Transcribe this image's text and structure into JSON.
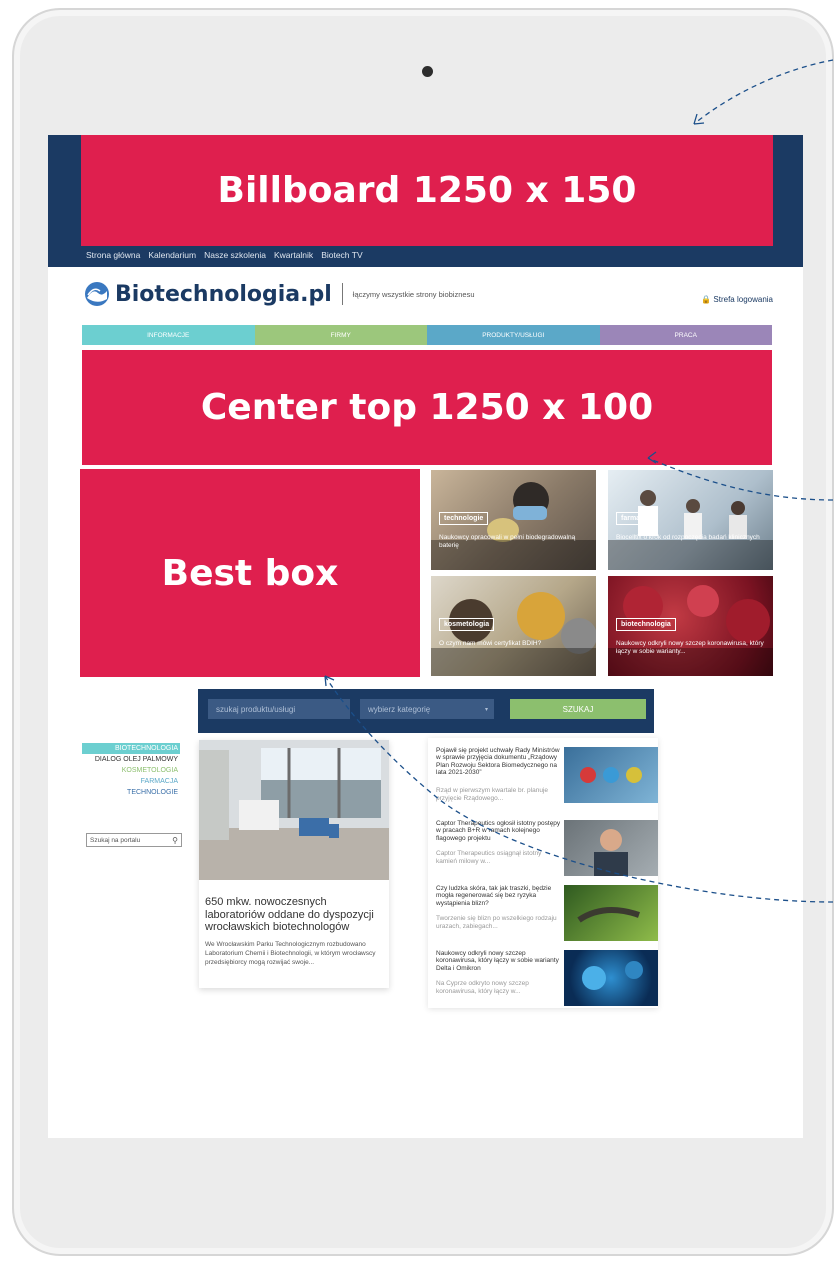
{
  "ads": {
    "billboard": "Billboard 1250 x 150",
    "center_top": "Center top 1250 x 100",
    "best_box": "Best box"
  },
  "top_nav": [
    "Strona główna",
    "Kalendarium",
    "Nasze szkolenia",
    "Kwartalnik",
    "Biotech TV"
  ],
  "logo": {
    "name": "Biotechnologia.pl",
    "tagline": "łączymy wszystkie strony biobiznesu"
  },
  "login": "Strefa logowania",
  "categories": [
    {
      "label": "INFORMACJE",
      "color": "#6ccfd0"
    },
    {
      "label": "FIRMY",
      "color": "#9cc77c"
    },
    {
      "label": "PRODUKTY/USŁUGI",
      "color": "#5ba8c8"
    },
    {
      "label": "PRACA",
      "color": "#9b86b8"
    }
  ],
  "tiles": [
    {
      "badge": "technologie",
      "title": "Naukowcy opracowali w pełni biodegradowalną baterię"
    },
    {
      "badge": "farmacja",
      "title": "Biocelltix o krok od rozpoczęcia badań klinicznych"
    },
    {
      "badge": "kosmetologia",
      "title": "O czym nam mówi certyfikat BDIH?"
    },
    {
      "badge": "biotechnologia",
      "title": "Naukowcy odkryli nowy szczep koronawirusa, który łączy w sobie warianty..."
    }
  ],
  "search": {
    "product_placeholder": "szukaj produktu/usługi",
    "category_placeholder": "wybierz kategorię",
    "button": "SZUKAJ"
  },
  "side_categories": [
    {
      "label": "BIOTECHNOLOGIA",
      "color": "#ffffff",
      "bg": "#6ccfd0"
    },
    {
      "label": "DIALOG OLEJ PALMOWY",
      "color": "#333333",
      "bg": "transparent"
    },
    {
      "label": "KOSMETOLOGIA",
      "color": "#8cbf6e",
      "bg": "transparent"
    },
    {
      "label": "FARMACJA",
      "color": "#5ba8c8",
      "bg": "transparent"
    },
    {
      "label": "TECHNOLOGIE",
      "color": "#3a6fa8",
      "bg": "transparent"
    }
  ],
  "side_search": "Szukaj na portalu",
  "main_article": {
    "title": "650 mkw. nowoczesnych laboratoriów oddane do dyspozycji wrocławskich biotechnologów",
    "excerpt": "We Wrocławskim Parku Technologicznym rozbudowano Laboratorium Chemii i Biotechnologii, w którym wrocławscy przedsiębiorcy mogą rozwijać swoje..."
  },
  "news": [
    {
      "title": "Pojawił się projekt uchwały Rady Ministrów w sprawie przyjęcia dokumentu „Rządowy Plan Rozwoju Sektora Biomedycznego na lata 2021-2030”",
      "excerpt": "Rząd w pierwszym kwartale br. planuje przyjęcie Rządowego..."
    },
    {
      "title": "Captor Therapeutics ogłosił istotny postępy w pracach B+R w ramach kolejnego flagowego projektu",
      "excerpt": "Captor Therapeutics osiągnął istotny kamień milowy w..."
    },
    {
      "title": "Czy ludzka skóra, tak jak traszki, będzie mogła regenerować się bez ryzyka wystąpienia blizn?",
      "excerpt": "Tworzenie się blizn po wszelkiego rodzaju urazach, zabiegach..."
    },
    {
      "title": "Naukowcy odkryli nowy szczep koronawirusa, który łączy w sobie warianty Delta i Omikron",
      "excerpt": "Na Cyprze odkryto nowy szczep koronawirusa, który łączy w..."
    }
  ]
}
